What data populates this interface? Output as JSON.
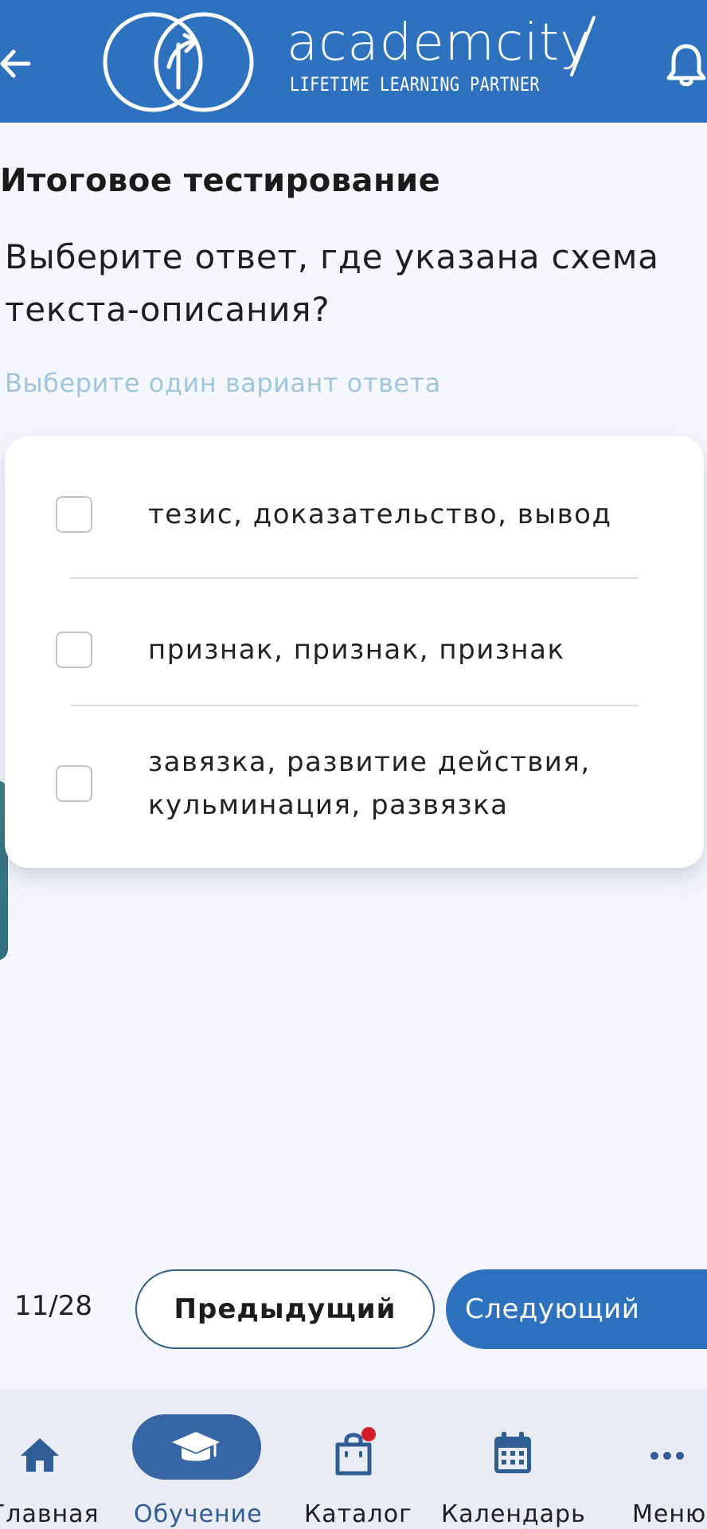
{
  "header": {
    "logo_word": "academcity",
    "logo_tagline": "LIFETIME LEARNING PARTNER",
    "back_icon": "arrow-left-icon",
    "bell_icon": "bell-icon",
    "brand_color": "#2e72bf"
  },
  "content": {
    "title": "Итоговое тестирование",
    "question": "Выберите ответ, где указана схема текста-описания?",
    "hint": "Выберите один вариант ответа",
    "options": [
      {
        "label": "тезис, доказательство, вывод",
        "checked": false
      },
      {
        "label": "признак, признак, признак",
        "checked": false
      },
      {
        "label": "завязка, развитие действия, кульминация, развязка",
        "checked": false
      }
    ]
  },
  "pager": {
    "counter": "11/28",
    "prev_label": "Предыдущий",
    "next_label": "Следующий"
  },
  "bottom_nav": {
    "items": [
      {
        "label": "Главная",
        "icon": "home-icon",
        "active": false
      },
      {
        "label": "Обучение",
        "icon": "graduation-cap-icon",
        "active": true
      },
      {
        "label": "Каталог",
        "icon": "shopping-bag-icon",
        "active": false,
        "badge": true
      },
      {
        "label": "Календарь",
        "icon": "calendar-icon",
        "active": false
      },
      {
        "label": "Меню",
        "icon": "more-icon",
        "active": false
      }
    ],
    "active_color": "#3565a2",
    "badge_color": "#d31d2a"
  }
}
